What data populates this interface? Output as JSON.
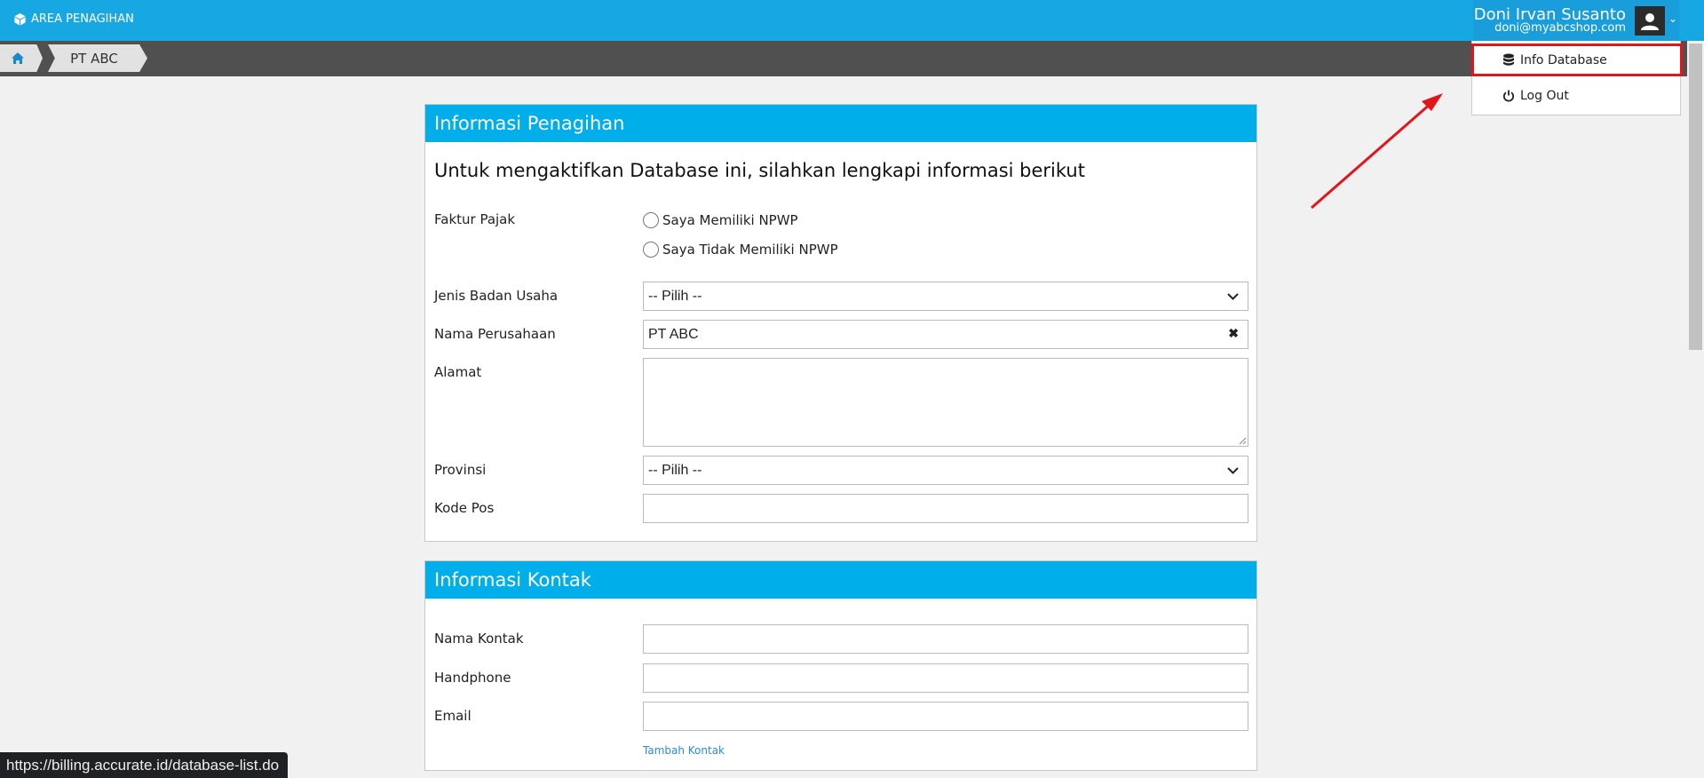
{
  "app": {
    "title": "AREA PENAGIHAN"
  },
  "user": {
    "name": "Doni Irvan Susanto",
    "email": "doni@myabcshop.com"
  },
  "breadcrumb": {
    "current": "PT ABC"
  },
  "menu": {
    "items": [
      {
        "label": "Info Database",
        "icon": "database-icon"
      },
      {
        "label": "Log Out",
        "icon": "power-icon"
      }
    ]
  },
  "billing": {
    "title": "Informasi Penagihan",
    "subtitle": "Untuk mengaktifkan Database ini, silahkan lengkapi informasi berikut",
    "tax": {
      "label": "Faktur Pajak",
      "options": [
        "Saya Memiliki NPWP",
        "Saya Tidak Memiliki NPWP"
      ]
    },
    "entity_type": {
      "label": "Jenis Badan Usaha",
      "value": "-- Pilih --"
    },
    "company": {
      "label": "Nama Perusahaan",
      "value": "PT ABC"
    },
    "address": {
      "label": "Alamat",
      "value": ""
    },
    "province": {
      "label": "Provinsi",
      "value": "-- Pilih --"
    },
    "postal_code": {
      "label": "Kode Pos",
      "value": ""
    }
  },
  "contact": {
    "title": "Informasi Kontak",
    "name": {
      "label": "Nama Kontak",
      "value": ""
    },
    "phone": {
      "label": "Handphone",
      "value": ""
    },
    "email": {
      "label": "Email",
      "value": ""
    },
    "add_link": "Tambah Kontak"
  },
  "status_url": "https://billing.accurate.id/database-list.do",
  "colors": {
    "topbar": "#17a8e3",
    "panel_header": "#00aeea",
    "highlight": "#e3151c"
  }
}
